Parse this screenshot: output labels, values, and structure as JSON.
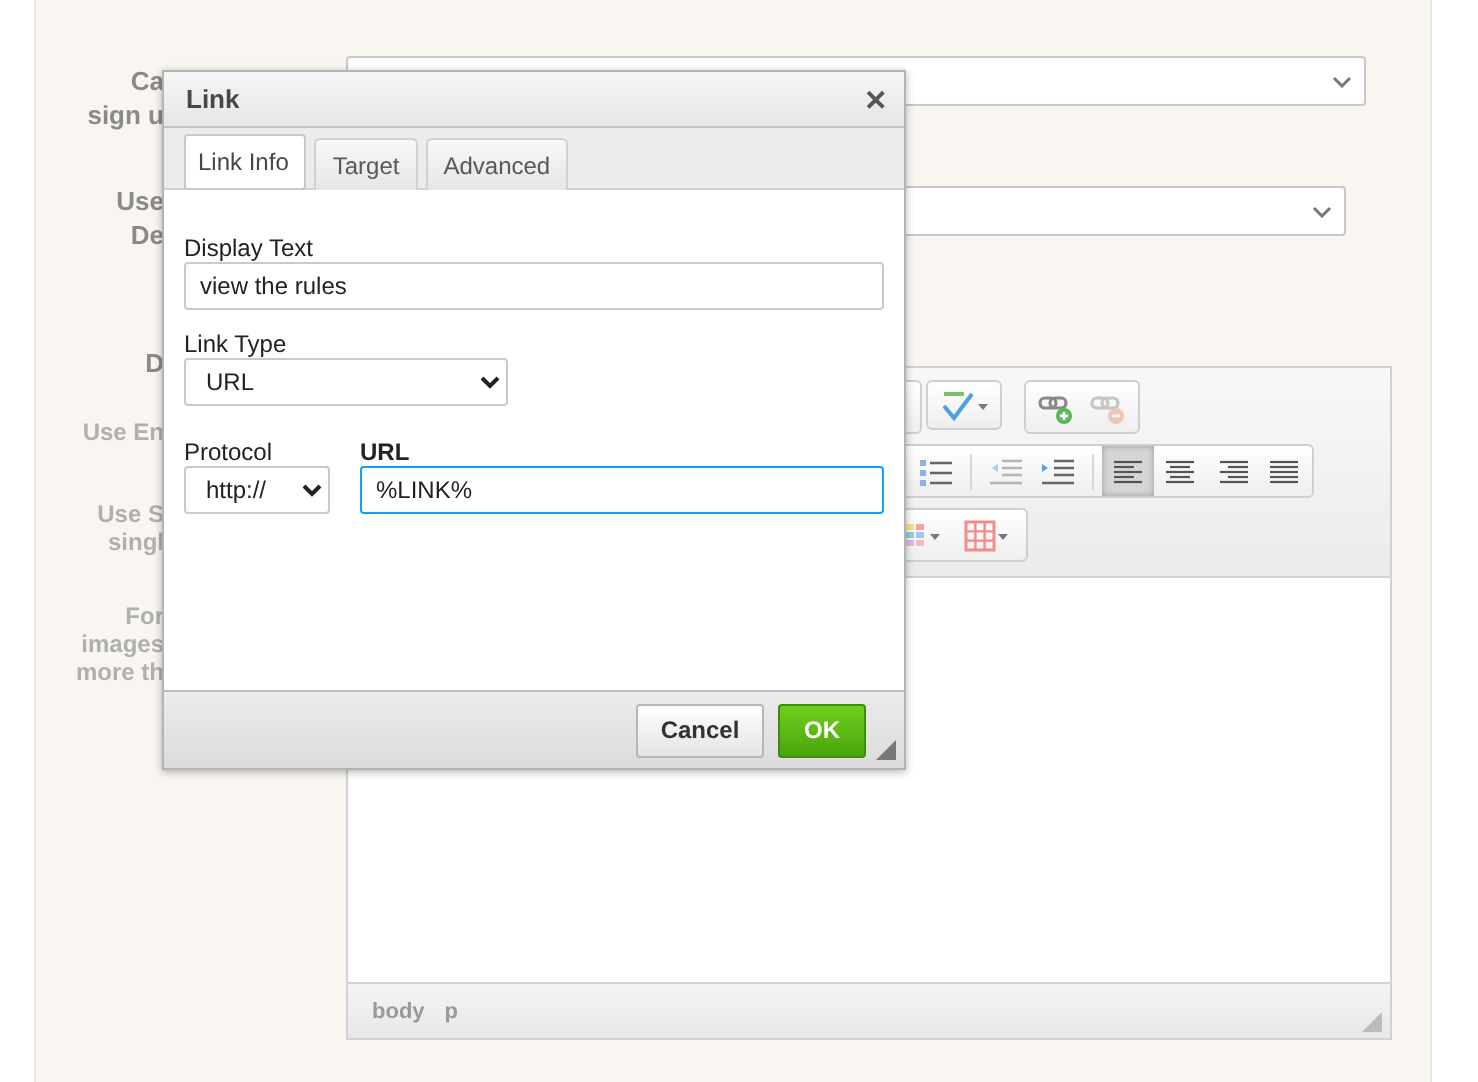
{
  "form": {
    "labels": [
      {
        "kind": "main",
        "lines": [
          "Ca",
          "sign u"
        ]
      },
      {
        "kind": "main",
        "lines": [
          "Use",
          "De"
        ]
      },
      {
        "kind": "main",
        "lines": [
          "D"
        ]
      },
      {
        "kind": "option",
        "lines": [
          "Use En"
        ]
      },
      {
        "kind": "option",
        "lines": [
          "Use S",
          "singl"
        ]
      },
      {
        "kind": "option",
        "lines": [
          "For",
          "images",
          "more th"
        ]
      }
    ],
    "selects": [
      {
        "kind": "dropdown"
      },
      {
        "kind": "dropdown"
      }
    ],
    "editor": {
      "toolbar": [
        [
          {
            "kind": "spellcheck",
            "active": false,
            "disabled": false
          },
          {
            "kind": "link",
            "active": false,
            "disabled": false
          },
          {
            "kind": "unlink",
            "active": false,
            "disabled": true
          }
        ],
        [
          {
            "kind": "bulleted-list",
            "active": false,
            "disabled": false
          },
          {
            "kind": "outdent",
            "active": false,
            "disabled": true
          },
          {
            "kind": "indent",
            "active": false,
            "disabled": false
          },
          {
            "kind": "align-left",
            "active": true,
            "disabled": false
          },
          {
            "kind": "align-center",
            "active": false,
            "disabled": false
          },
          {
            "kind": "align-right",
            "active": false,
            "disabled": false
          },
          {
            "kind": "justify",
            "active": false,
            "disabled": false
          }
        ],
        [
          {
            "kind": "color-grid",
            "active": false,
            "disabled": false
          },
          {
            "kind": "table",
            "active": false,
            "disabled": false
          }
        ]
      ],
      "path": [
        "body",
        "p"
      ]
    }
  },
  "dialog": {
    "title": "Link",
    "close": "✕",
    "tabs": [
      {
        "label": "Link Info",
        "selected": true
      },
      {
        "label": "Target",
        "selected": false
      },
      {
        "label": "Advanced",
        "selected": false
      }
    ],
    "display_text": {
      "label": "Display Text",
      "value": "view the rules"
    },
    "link_type": {
      "label": "Link Type",
      "value": "URL"
    },
    "protocol": {
      "label": "Protocol",
      "value": "http://"
    },
    "url": {
      "label": "URL",
      "value": "%LINK%",
      "focused": true
    },
    "buttons": [
      {
        "label": "Cancel",
        "kind": "secondary"
      },
      {
        "label": "OK",
        "kind": "primary"
      }
    ]
  }
}
